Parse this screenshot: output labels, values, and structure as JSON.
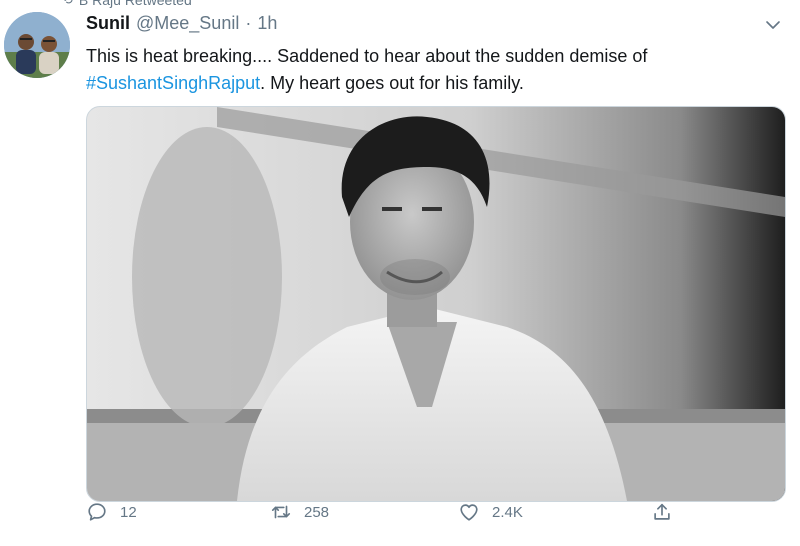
{
  "retweet_banner": {
    "text": "B Raju Retweeted"
  },
  "author": {
    "name": "Sunil",
    "handle": "@Mee_Sunil",
    "separator": "·",
    "time": "1h"
  },
  "tweet": {
    "text_before": "This is heat breaking.... Saddened to hear about the sudden demise of ",
    "hashtag": "#SushantSinghRajput",
    "text_after": ". My heart goes out for his family."
  },
  "actions": {
    "replies": "12",
    "retweets": "258",
    "likes": "2.4K"
  },
  "colors": {
    "link": "#1b95e0",
    "muted": "#657786",
    "text": "#14171a"
  },
  "icons": [
    "retweet-icon",
    "chevron-down-icon",
    "reply-icon",
    "retweet-icon",
    "like-icon",
    "share-icon"
  ]
}
